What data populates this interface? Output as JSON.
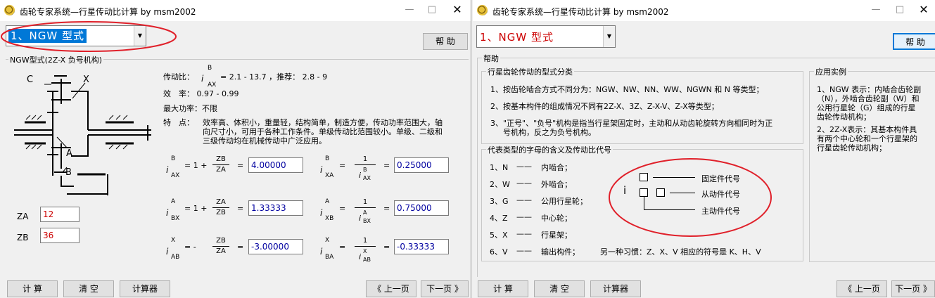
{
  "left": {
    "title": "齿轮专家系统—行星传动比计算 by msm2002",
    "combo_value": "1、NGW 型式",
    "help_button": "帮 助",
    "group_title": "NGW型式(2Z-X 负号机构)",
    "diagram_labels": {
      "c": "C",
      "x": "X",
      "a": "A",
      "b": "B"
    },
    "ratio_prefix": "传动比：",
    "ratio_value": "= 2.1 - 13.7 ，推荐： 2.8 - 9",
    "efficiency": "效　率： 0.97 - 0.99",
    "max_power": "最大功率：不限",
    "features_label": "特　点：",
    "features_lines": [
      "效率高、体积小，重量轻，结构简单，制造方便，传动功率范围大，轴",
      "向尺寸小，可用于各种工作条件。单级传动比范围较小。单级、二级和",
      "三级传动均在机械传动中广泛应用。"
    ],
    "za_label": "ZA",
    "zb_label": "ZB",
    "za_value": "12",
    "zb_value": "36",
    "formulas": {
      "r1": {
        "i_sup": "B",
        "i_sub": "AX",
        "expr": "= 1 +",
        "f_num": "ZB",
        "f_den": "ZA",
        "eq": "=",
        "value": "4.00000",
        "j_sup": "B",
        "j_sub": "XA",
        "eq2": "=",
        "g_num": "1",
        "g_den_sup": "B",
        "g_den_sub": "AX",
        "eq3": "=",
        "value2": "0.25000"
      },
      "r2": {
        "i_sup": "A",
        "i_sub": "BX",
        "expr": "= 1 +",
        "f_num": "ZA",
        "f_den": "ZB",
        "eq": "=",
        "value": "1.33333",
        "j_sup": "A",
        "j_sub": "XB",
        "eq2": "=",
        "g_num": "1",
        "g_den_sup": "A",
        "g_den_sub": "BX",
        "eq3": "=",
        "value2": "0.75000"
      },
      "r3": {
        "i_sup": "X",
        "i_sub": "AB",
        "expr": "= -",
        "f_num": "ZB",
        "f_den": "ZA",
        "eq": "=",
        "value": "-3.00000",
        "j_sup": "X",
        "j_sub": "BA",
        "eq2": "=",
        "g_num": "1",
        "g_den_sup": "X",
        "g_den_sub": "AB",
        "eq3": "=",
        "value2": "-0.33333"
      }
    },
    "buttons": {
      "calc": "计 算",
      "clear": "清 空",
      "calculator": "计算器",
      "prev": "《 上一页",
      "next": "下一页 》"
    }
  },
  "right": {
    "title": "齿轮专家系统—行星传动比计算 by msm2002",
    "combo_value": "1、NGW 型式",
    "help_button": "帮 助",
    "help_group_title": "帮助",
    "types_title": "行星齿轮传动的型式分类",
    "types_lines": [
      "1、按齿轮啮合方式不同分为：NGW、NW、NN、WW、NGWN 和 N 等类型；",
      "2、按基本构件的组成情况不同有2Z-X、3Z、Z-X-V、Z-X等类型；",
      "3、\"正号\"、\"负号\"机构是指当行星架固定时，主动和从动齿轮旋转方向相同时为正",
      "号机构，反之为负号机构。"
    ],
    "apps_title": "应用实例",
    "apps_lines": [
      "1、NGW 表示：内啮合齿轮副",
      "（N），外啮合齿轮副（W）和",
      "公用行星轮（G）组成的行星",
      "齿轮传动机构；",
      "2、2Z-X表示：其基本构件具",
      "有两个中心轮和一个行星架的",
      "行星齿轮传动机构；"
    ],
    "letters_title": "代表类型的字母的含义及传动比代号",
    "letters": [
      {
        "code": "1、N",
        "dash": "——",
        "meaning": "内啮合；"
      },
      {
        "code": "2、W",
        "dash": "——",
        "meaning": "外啮合；"
      },
      {
        "code": "3、G",
        "dash": "——",
        "meaning": "公用行星轮；"
      },
      {
        "code": "4、Z",
        "dash": "——",
        "meaning": "中心轮；"
      },
      {
        "code": "5、X",
        "dash": "——",
        "meaning": "行星架；"
      },
      {
        "code": "6、V",
        "dash": "——",
        "meaning": "输出构件；"
      }
    ],
    "note": "另一种习惯：Z、X、V 相应的符号是 K、H、V",
    "notation_i": "i",
    "notation_fixed": "固定件代号",
    "notation_driven": "从动件代号",
    "notation_driver": "主动件代号",
    "buttons": {
      "calc": "计 算",
      "clear": "清 空",
      "calculator": "计算器",
      "prev": "《 上一页",
      "next": "下一页 》"
    }
  },
  "colors": {
    "highlight": "#0078d7",
    "red_text": "#cc0000",
    "value_blue": "#0000a0",
    "annotation_ellipse": "#e0202a"
  }
}
